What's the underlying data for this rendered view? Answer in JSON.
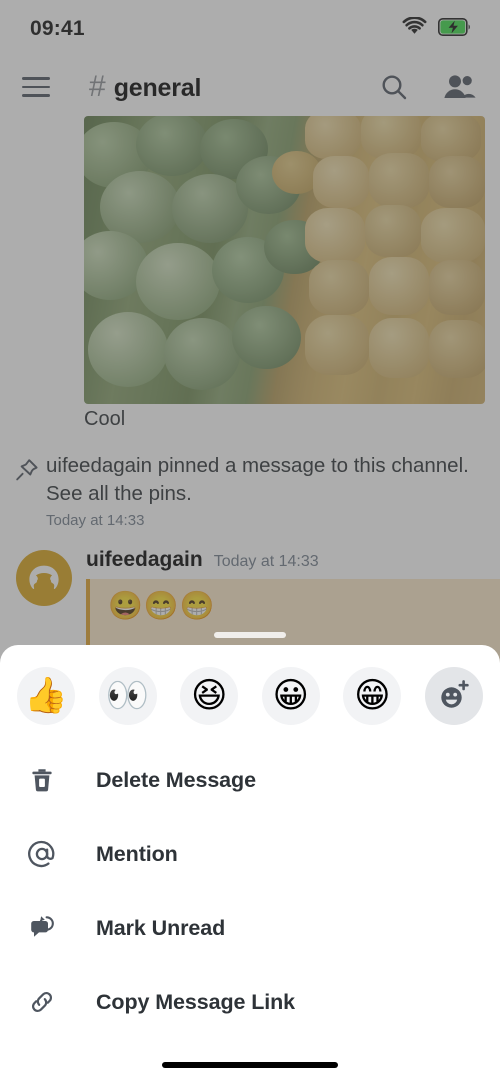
{
  "status_bar": {
    "time": "09:41",
    "wifi_icon": "wifi-icon",
    "battery_icon": "battery-charging-icon",
    "battery_color": "#3ddc4a"
  },
  "header": {
    "menu_icon": "hamburger-menu-icon",
    "hash": "#",
    "channel_name": "general",
    "search_icon": "search-icon",
    "members_icon": "members-icon"
  },
  "messages": {
    "attachment": {
      "alt": "frozen-peas-and-corn-photo",
      "caption": "Cool"
    },
    "pinned_notice": {
      "icon": "pin-icon",
      "text": "uifeedagain pinned a message to this channel. See all the pins.",
      "timestamp": "Today at 14:33"
    },
    "highlighted": {
      "avatar_icon": "discord-avatar-icon",
      "avatar_color": "#d9a41e",
      "author": "uifeedagain",
      "timestamp": "Today at 14:33",
      "content": "😀😁😁"
    }
  },
  "action_sheet": {
    "drag_handle": "sheet-drag-handle",
    "reactions": [
      {
        "name": "reaction-thumbs-up",
        "glyph": "👍",
        "label": "Thumbs Up"
      },
      {
        "name": "reaction-eyes",
        "glyph": "👀",
        "label": "Eyes"
      },
      {
        "name": "reaction-laughing",
        "glyph": "😆",
        "label": "Laughing"
      },
      {
        "name": "reaction-grinning",
        "glyph": "😀",
        "label": "Grinning"
      },
      {
        "name": "reaction-beaming",
        "glyph": "😁",
        "label": "Beaming"
      },
      {
        "name": "reaction-add-more",
        "glyph": "",
        "label": "Add Reaction"
      }
    ],
    "menu_items": [
      {
        "icon": "trash-icon",
        "label": "Delete Message"
      },
      {
        "icon": "mention-at-icon",
        "label": "Mention"
      },
      {
        "icon": "mark-unread-icon",
        "label": "Mark Unread"
      },
      {
        "icon": "link-icon",
        "label": "Copy Message Link"
      }
    ]
  },
  "home_indicator": "home-indicator"
}
